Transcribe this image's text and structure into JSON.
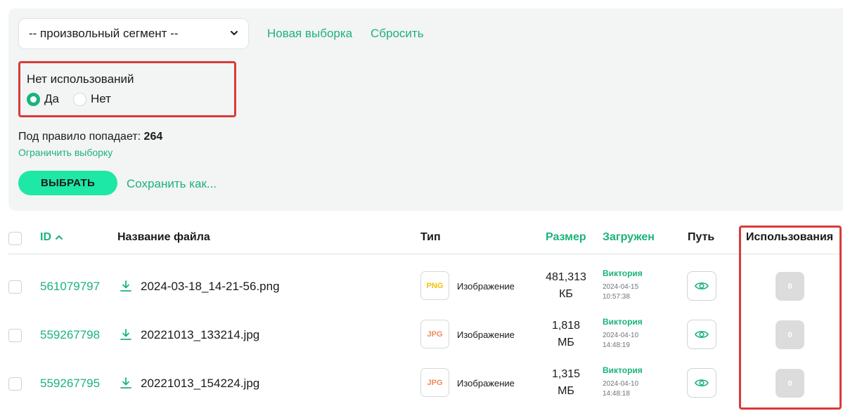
{
  "filters": {
    "segment_select_value": "-- произвольный сегмент --",
    "new_selection": "Новая выборка",
    "reset": "Сбросить",
    "no_usage": {
      "title": "Нет использований",
      "options": [
        {
          "label": "Да",
          "selected": true
        },
        {
          "label": "Нет",
          "selected": false
        }
      ]
    },
    "match_label": "Под правило попадает:",
    "match_count": "264",
    "limit_link": "Ограничить выборку",
    "select_button": "ВЫБРАТЬ",
    "save_as": "Сохранить как..."
  },
  "table": {
    "columns": {
      "id": "ID",
      "filename": "Название файла",
      "type": "Тип",
      "size": "Размер",
      "uploaded": "Загружен",
      "path": "Путь",
      "usages": "Использования"
    },
    "rows": [
      {
        "id": "561079797",
        "filename": "2024-03-18_14-21-56.png",
        "type_badge": "PNG",
        "type_label": "Изображение",
        "size_value": "481,313",
        "size_unit": "КБ",
        "uploader": "Виктория",
        "date": "2024-04-15",
        "time": "10:57:38",
        "usages": "0"
      },
      {
        "id": "559267798",
        "filename": "20221013_133214.jpg",
        "type_badge": "JPG",
        "type_label": "Изображение",
        "size_value": "1,818",
        "size_unit": "МБ",
        "uploader": "Виктория",
        "date": "2024-04-10",
        "time": "14:48:19",
        "usages": "0"
      },
      {
        "id": "559267795",
        "filename": "20221013_154224.jpg",
        "type_badge": "JPG",
        "type_label": "Изображение",
        "size_value": "1,315",
        "size_unit": "МБ",
        "uploader": "Виктория",
        "date": "2024-04-10",
        "time": "14:48:18",
        "usages": "0"
      }
    ]
  },
  "colors": {
    "accent_green": "#1bb37a",
    "button_green": "#1de8a6",
    "highlight_red": "#d93a3a",
    "png_badge": "#f2c200",
    "jpg_badge": "#f08a5b"
  }
}
